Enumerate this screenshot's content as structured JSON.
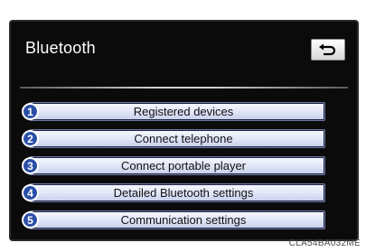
{
  "screen": {
    "title": "Bluetooth",
    "back_icon": "return-arrow-icon"
  },
  "menu": {
    "items": [
      {
        "number": "1",
        "label": "Registered devices"
      },
      {
        "number": "2",
        "label": "Connect telephone"
      },
      {
        "number": "3",
        "label": "Connect portable player"
      },
      {
        "number": "4",
        "label": "Detailed Bluetooth settings"
      },
      {
        "number": "5",
        "label": "Communication settings"
      }
    ]
  },
  "figure": {
    "ref_code": "CLA54BA032ME"
  },
  "colors": {
    "screen_bg": "#0b0b0b",
    "button_face": "#dfe4f7",
    "callout_blue": "#2b4fa8"
  }
}
